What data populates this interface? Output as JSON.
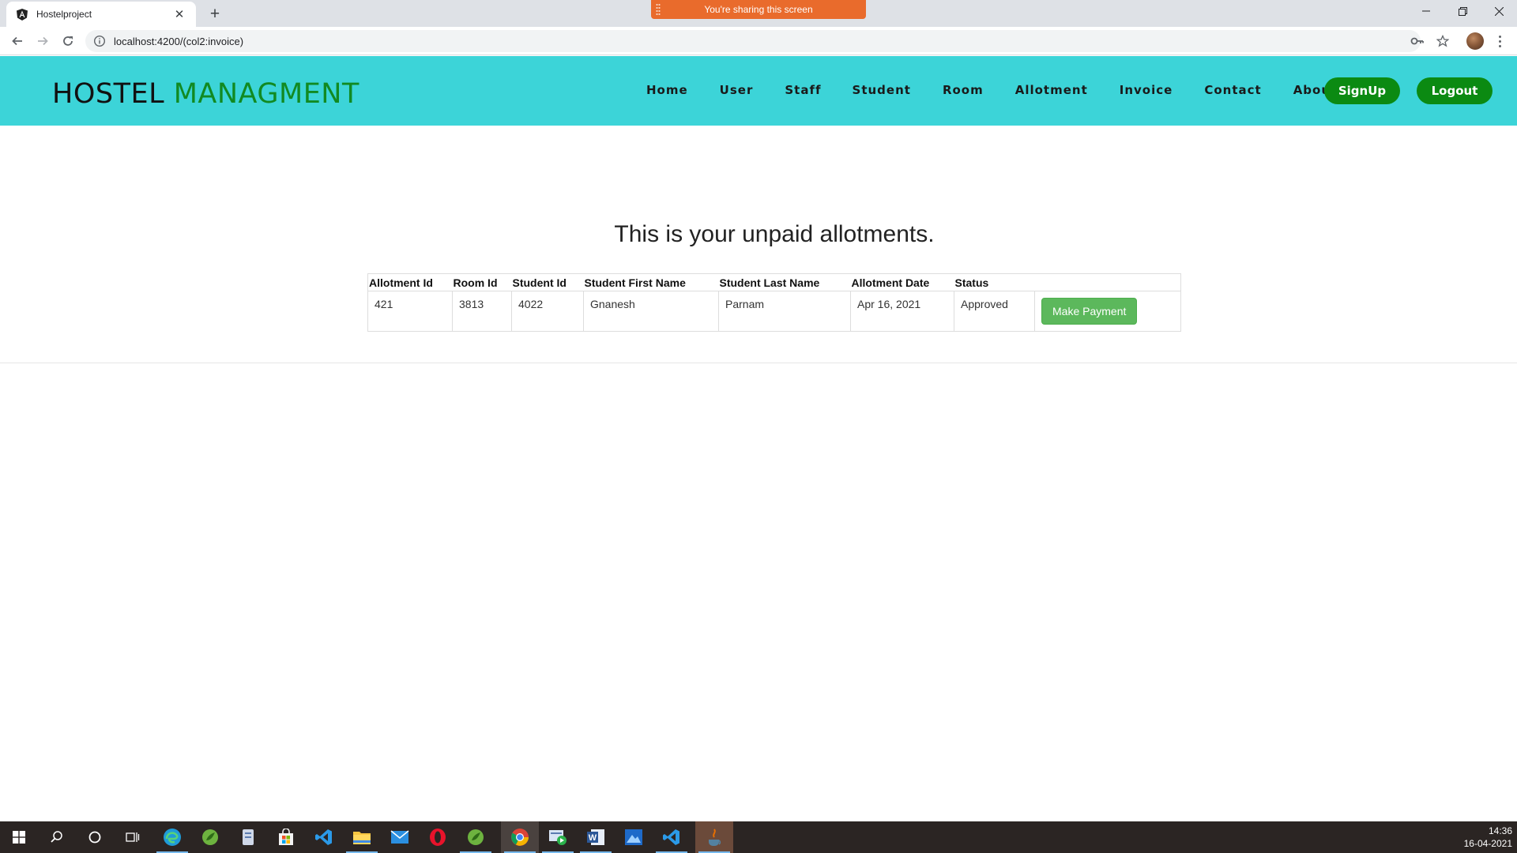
{
  "browser": {
    "tab_title": "Hostelproject",
    "url": "localhost:4200/(col2:invoice)",
    "share_banner": "You're sharing this screen"
  },
  "navbar": {
    "brand_part1": "HOSTEL",
    "brand_part2": "MANAGMENT",
    "links": [
      "Home",
      "User",
      "Staff",
      "Student",
      "Room",
      "Allotment",
      "Invoice",
      "Contact",
      "About"
    ],
    "signup_label": "SignUp",
    "logout_label": "Logout"
  },
  "main": {
    "heading": "This is your unpaid allotments.",
    "columns": [
      "Allotment Id",
      "Room Id",
      "Student Id",
      "Student First Name",
      "Student Last Name",
      "Allotment Date",
      "Status"
    ],
    "rows": [
      {
        "allotment_id": "421",
        "room_id": "3813",
        "student_id": "4022",
        "first_name": "Gnanesh",
        "last_name": "Parnam",
        "allotment_date": "Apr 16, 2021",
        "status": "Approved"
      }
    ],
    "pay_button_label": "Make Payment"
  },
  "taskbar": {
    "time": "14:36",
    "date": "16-04-2021"
  },
  "colors": {
    "navbar_bg": "#3cd4d8",
    "brand_green": "#118a22",
    "pill_green": "#0b8a12",
    "pay_button": "#5cb85c",
    "share_banner": "#e96b2c"
  }
}
